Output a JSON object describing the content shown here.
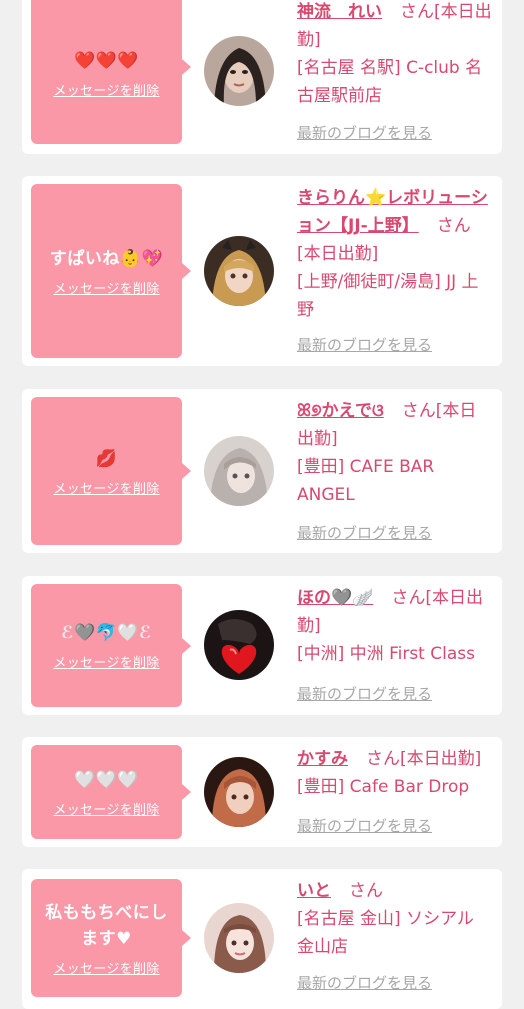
{
  "cards": [
    {
      "message": "❤️❤️❤️",
      "delete_label": "メッセージを削除",
      "name": "神流　れい",
      "suffix": "さん[本日出勤]",
      "shop": "[名古屋 名駅] C-club 名古屋駅前店",
      "blog": "最新のブログを見る"
    },
    {
      "message": "すぱいね👶💖",
      "delete_label": "メッセージを削除",
      "name": "きらりん⭐レボリューション【JJ-上野】",
      "suffix": "さん[本日出勤]",
      "shop": "[上野/御徒町/湯島] JJ 上野",
      "blog": "最新のブログを見る"
    },
    {
      "message": "💋",
      "delete_label": "メッセージを削除",
      "name": "ꕤ୭かえでଓ",
      "suffix": "さん[本日出勤]",
      "shop": "[豊田] CAFE BAR ANGEL",
      "blog": "最新のブログを見る"
    },
    {
      "message": "ℰ🩶🐬🤍ℰ",
      "delete_label": "メッセージを削除",
      "name": "ほの🩶🪽",
      "suffix": "さん[本日出勤]",
      "shop": "[中洲] 中洲 First Class",
      "blog": "最新のブログを見る"
    },
    {
      "message": "🤍🤍🤍",
      "delete_label": "メッセージを削除",
      "name": "かすみ",
      "suffix": "さん[本日出勤]",
      "shop": "[豊田] Cafe Bar Drop",
      "blog": "最新のブログを見る"
    },
    {
      "message": "私ももちべにします♥",
      "delete_label": "メッセージを削除",
      "name": "いと",
      "suffix": "さん",
      "shop": "[名古屋 金山] ソシアル 金山店",
      "blog": "最新のブログを見る"
    }
  ],
  "colors": {
    "bubble": "#fb98a8",
    "link": "#d9486f",
    "muted": "#a7a7a7",
    "background": "#f0f0f0"
  }
}
